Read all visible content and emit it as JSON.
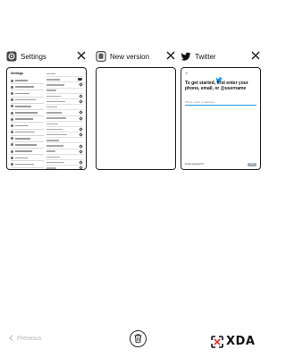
{
  "recents": {
    "cards": [
      {
        "title": "Settings",
        "icon": "gear-icon",
        "close_icon": "close-icon",
        "preview": {
          "heading": "Settings",
          "left_items": [
            "",
            "",
            "",
            "",
            "",
            "",
            "",
            "",
            "",
            "",
            "",
            "",
            "",
            ""
          ],
          "right_items": [
            "",
            "",
            "",
            "",
            "",
            "",
            "",
            "",
            "",
            "",
            "",
            "",
            "",
            "",
            "",
            "",
            "",
            ""
          ]
        }
      },
      {
        "title": "New version",
        "icon": "app-icon",
        "close_icon": "close-icon"
      },
      {
        "title": "Twitter",
        "icon": "twitter-bird-icon",
        "close_icon": "close-icon",
        "preview": {
          "close": "✕",
          "heading": "To get started, first enter your phone, email, or @username",
          "input_placeholder": "Phone, email, or username",
          "forgot_link": "Forgot password?",
          "next_button": "Next"
        }
      }
    ]
  },
  "footer": {
    "previous_label": "Previous",
    "clear_all_icon": "trash-icon",
    "brand": "XDA"
  },
  "colors": {
    "twitter_blue": "#1d9bf0",
    "disabled_gray": "#b5b5b5"
  }
}
